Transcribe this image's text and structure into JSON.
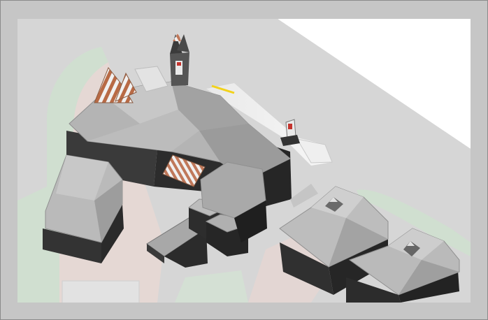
{
  "scene": {
    "kind": "3d-isometric-architectural-massing-model",
    "colors": {
      "frame": "#c6c6c6",
      "ground": "#d6d6d6",
      "sky": "#ffffff",
      "green_space": "#cfe0cf",
      "paving": "#e8d8d4",
      "roof_light": "#bdbdbd",
      "roof_mid": "#9f9f9f",
      "wall_dark": "#2e2e2e",
      "road_marking": "#f2d21b",
      "awning_stripe_a": "#b86a45",
      "awning_stripe_b": "#f1f1f1"
    },
    "icons": [
      "building-icon",
      "awning-icon",
      "tower-icon",
      "road-icon"
    ]
  }
}
